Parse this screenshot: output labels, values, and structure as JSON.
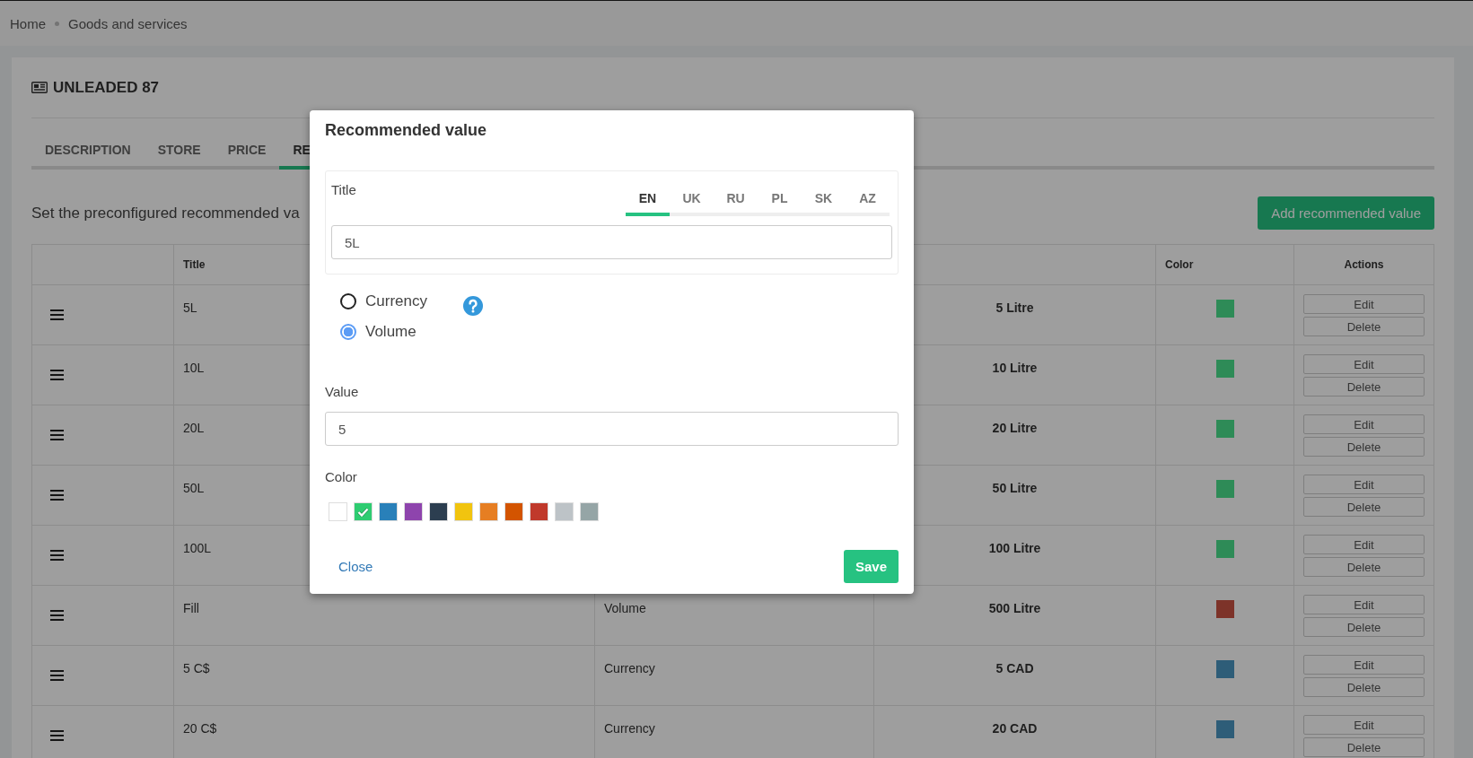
{
  "breadcrumb": [
    "Home",
    "Goods and services"
  ],
  "product": {
    "title": "UNLEADED 87"
  },
  "tabs": [
    {
      "label": "DESCRIPTION",
      "selected": false
    },
    {
      "label": "STORE",
      "selected": false
    },
    {
      "label": "PRICE",
      "selected": false
    },
    {
      "label": "RE",
      "selected": true
    }
  ],
  "description": "Set the preconfigured recommended va",
  "add_button": "Add recommended value",
  "table": {
    "columns": [
      "Title",
      "Color",
      "Actions"
    ],
    "rows": [
      {
        "title": "5L",
        "value": "5 Litre",
        "color": "#2e8b57",
        "actions": [
          "Edit",
          "Delete"
        ]
      },
      {
        "title": "10L",
        "value": "10 Litre",
        "color": "#2e8b57",
        "actions": [
          "Edit",
          "Delete"
        ]
      },
      {
        "title": "20L",
        "value": "20 Litre",
        "color": "#2e8b57",
        "actions": [
          "Edit",
          "Delete"
        ]
      },
      {
        "title": "50L",
        "value": "50 Litre",
        "color": "#2e8b57",
        "actions": [
          "Edit",
          "Delete"
        ]
      },
      {
        "title": "100L",
        "value": "100 Litre",
        "color": "#2e8b57",
        "actions": [
          "Edit",
          "Delete"
        ]
      },
      {
        "title": "Fill",
        "type": "Volume",
        "value": "500 Litre",
        "color": "#7d3329",
        "actions": [
          "Edit",
          "Delete"
        ]
      },
      {
        "title": "5 C$",
        "type": "Currency",
        "value": "5 CAD",
        "color": "#2e5d78",
        "actions": [
          "Edit",
          "Delete"
        ]
      },
      {
        "title": "20 C$",
        "type": "Currency",
        "value": "20 CAD",
        "color": "#2e5d78",
        "actions": [
          "Edit",
          "Delete"
        ]
      }
    ]
  },
  "modal": {
    "title": "Recommended value",
    "title_label": "Title",
    "languages": [
      {
        "label": "EN",
        "selected": true
      },
      {
        "label": "UK",
        "selected": false
      },
      {
        "label": "RU",
        "selected": false
      },
      {
        "label": "PL",
        "selected": false
      },
      {
        "label": "SK",
        "selected": false
      },
      {
        "label": "AZ",
        "selected": false
      }
    ],
    "title_value": "5L",
    "types": [
      {
        "label": "Currency",
        "selected": false
      },
      {
        "label": "Volume",
        "selected": true
      }
    ],
    "value_label": "Value",
    "value": "5",
    "color_label": "Color",
    "swatches": [
      {
        "color": "#ffffff",
        "selected": false
      },
      {
        "color": "#2ecc71",
        "selected": true
      },
      {
        "color": "#2980b9",
        "selected": false
      },
      {
        "color": "#8e44ad",
        "selected": false
      },
      {
        "color": "#2c3e50",
        "selected": false
      },
      {
        "color": "#f1c40f",
        "selected": false
      },
      {
        "color": "#e67e22",
        "selected": false
      },
      {
        "color": "#d35400",
        "selected": false
      },
      {
        "color": "#c0392b",
        "selected": false
      },
      {
        "color": "#bdc3c7",
        "selected": false
      },
      {
        "color": "#95a5a6",
        "selected": false
      }
    ],
    "close": "Close",
    "save": "Save"
  }
}
